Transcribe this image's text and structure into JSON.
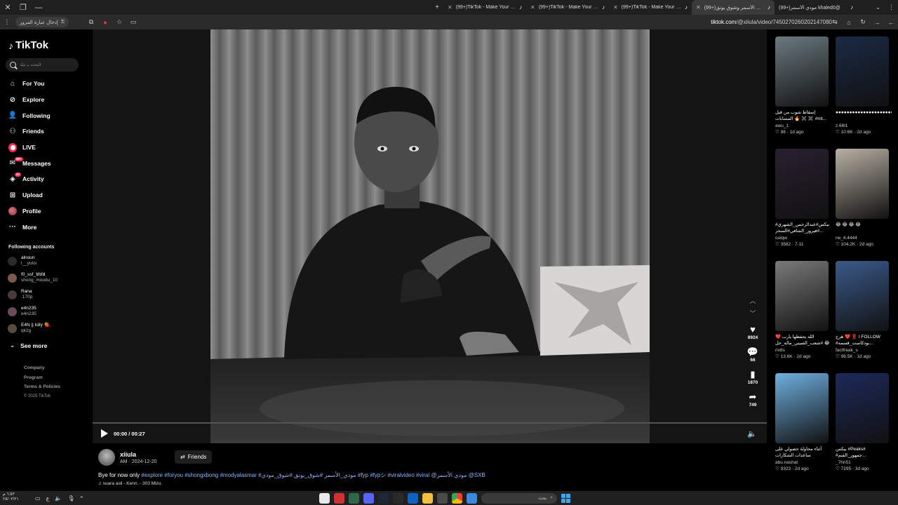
{
  "browser": {
    "tabs": [
      {
        "title": "(99+)TikTok - Make Your Day",
        "active": false
      },
      {
        "title": "(99+)TikTok - Make Your Day",
        "active": false
      },
      {
        "title": "(99+)TikTok - Make Your Day",
        "active": false
      },
      {
        "title": "(99+)مودي الأسمر وشوق يونق",
        "active": true
      },
      {
        "title": "(99+)مودي الأسمر khaled0@",
        "active": false
      }
    ],
    "address_hint": "إدخال عبارة المرور",
    "url_host": "tiktok.com",
    "url_path": "/@xiiula/video/7450270260202147080"
  },
  "sidebar": {
    "logo": "TikTok",
    "search_placeholder": "البحث بـ تيك",
    "nav": [
      {
        "label": "For You",
        "icon": "home-icon",
        "badge": ""
      },
      {
        "label": "Explore",
        "icon": "compass-icon",
        "badge": ""
      },
      {
        "label": "Following",
        "icon": "following-icon",
        "badge": ""
      },
      {
        "label": "Friends",
        "icon": "friends-icon",
        "badge": ""
      },
      {
        "label": "LIVE",
        "icon": "live-icon",
        "badge": ""
      },
      {
        "label": "Messages",
        "icon": "messages-icon",
        "badge": "99+"
      },
      {
        "label": "Activity",
        "icon": "activity-icon",
        "badge": "47"
      },
      {
        "label": "Upload",
        "icon": "upload-icon",
        "badge": ""
      },
      {
        "label": "Profile",
        "icon": "profile-icon",
        "badge": ""
      },
      {
        "label": "More",
        "icon": "more-icon",
        "badge": ""
      }
    ],
    "following_heading": "Following accounts",
    "following": [
      {
        "name": "alnouri",
        "sub": "l__yuloi"
      },
      {
        "name": "f0_ssf_ꓤꓤꓤ",
        "sub": "shong_moodu_10"
      },
      {
        "name": "Rana",
        "sub": ".170p"
      },
      {
        "name": "e4n235",
        "sub": "e4n235"
      },
      {
        "name": "E4N || lolly 🍓.",
        "sub": "qk2g"
      }
    ],
    "see_more": "See more",
    "footer": [
      "Company",
      "Program",
      "Terms & Policies"
    ],
    "copyright": "© 2025 TikTok"
  },
  "player": {
    "time": "00:00 / 00:27",
    "progress": 0,
    "likes": "8924",
    "comments": "66",
    "saves": "1870",
    "shares": "749"
  },
  "post": {
    "author": "xiiula",
    "date": "AM · 2024-12-20",
    "friends_label": "Friends",
    "caption_text": "Bye for now only ",
    "caption_tags": "#explore #foryou #shongxbong #modyalasmar #مودي_الأسمر #شوق_يونق #شوق_مودي #fyp #fypシ #viralvideo #viral @مودي الأسمر @SXB",
    "sound": "♫ suara asli - Kenn. - 303 Mizu."
  },
  "grid": [
    {
      "title": "إسقاط شوب من قبل المسابات 🔥 ✖️ ✖️ #mt...",
      "user": "awu_1",
      "likes": "98",
      "age": "1d ago",
      "color": "#6b7a80"
    },
    {
      "title": "●●●●●●●●●●●●●●●●●●●●●●●●",
      "user": "z.66l1",
      "likes": "10.6K",
      "age": "2d ago",
      "color": "#1a2a44"
    },
    {
      "title": "بيكس#عبدالرحمن_الشهري# #فيروز_الشافي#السحر...",
      "user": "oulqw",
      "likes": "3582",
      "age": "7-11",
      "color": "#2a2030"
    },
    {
      "title": "😂 😂 😂 😂",
      "user": "ne_4.4444",
      "likes": "104.2K",
      "age": "2d ago",
      "color": "#b8b0a4"
    },
    {
      "title": "الله يحفظها يارب ❤️ #شعب_الصيني_ماله_حل 😂",
      "user": "rix8s",
      "likes": "13.6K",
      "age": "2d ago",
      "color": "#7a7a7a"
    },
    {
      "title": "هرج ❤️ ‼️ I FOLLOW #بودكاست_قسمه...",
      "user": "factfreak_s",
      "likes": "96.5K",
      "age": "1d ago",
      "color": "#3a5a8a"
    },
    {
      "title": "أثناء محاولة حصولي على ساعدات الشكارات",
      "user": "abu.nashat",
      "likes": "9323",
      "age": "2d ago",
      "color": "#6fb0e0"
    },
    {
      "title": "بيكس #Peaks# #جمهور_الفنم...",
      "user": "_7hn51",
      "likes": "7295",
      "age": "3d ago",
      "color": "#1c2a5a"
    }
  ],
  "taskbar": {
    "search_placeholder": "بحث",
    "clock": "٦:٥٣ م",
    "date": "٢٥/٠٢/٢١"
  }
}
